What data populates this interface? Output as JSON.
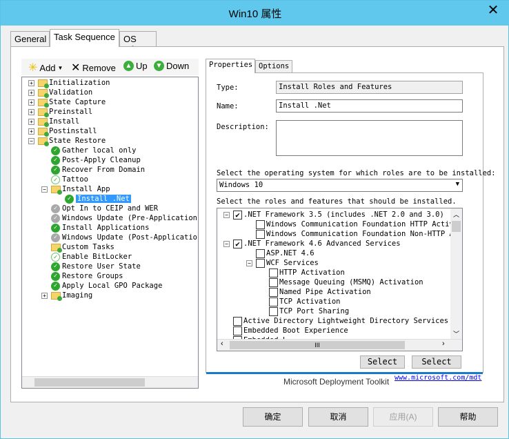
{
  "window": {
    "title": "Win10 属性",
    "close": "✕"
  },
  "tabs": [
    {
      "label": "General"
    },
    {
      "label": "Task Sequence",
      "active": true
    },
    {
      "label": "OS Info"
    }
  ],
  "toolbar": {
    "add": "Add",
    "remove": "Remove",
    "up": "Up",
    "down": "Down"
  },
  "tree": [
    {
      "label": "Initialization",
      "level": 0,
      "type": "folder",
      "expander": "+"
    },
    {
      "label": "Validation",
      "level": 0,
      "type": "folder",
      "expander": "+"
    },
    {
      "label": "State Capture",
      "level": 0,
      "type": "folder",
      "expander": "+"
    },
    {
      "label": "Preinstall",
      "level": 0,
      "type": "folder",
      "expander": "+"
    },
    {
      "label": "Install",
      "level": 0,
      "type": "folder",
      "expander": "+"
    },
    {
      "label": "Postinstall",
      "level": 0,
      "type": "folder",
      "expander": "+"
    },
    {
      "label": "State Restore",
      "level": 0,
      "type": "folder",
      "expander": "−"
    },
    {
      "label": "Gather local only",
      "level": 1,
      "type": "g"
    },
    {
      "label": "Post-Apply Cleanup",
      "level": 1,
      "type": "g"
    },
    {
      "label": "Recover From Domain",
      "level": 1,
      "type": "g"
    },
    {
      "label": "Tattoo",
      "level": 1,
      "type": "l"
    },
    {
      "label": "Install App",
      "level": 1,
      "type": "folder",
      "expander": "−"
    },
    {
      "label": "Install .Net",
      "level": 2,
      "type": "g",
      "selected": true
    },
    {
      "label": "Opt In to CEIP and WER",
      "level": 1,
      "type": "d"
    },
    {
      "label": "Windows Update (Pre-Application I",
      "level": 1,
      "type": "d"
    },
    {
      "label": "Install Applications",
      "level": 1,
      "type": "g"
    },
    {
      "label": "Windows Update (Post-Application",
      "level": 1,
      "type": "d"
    },
    {
      "label": "Custom Tasks",
      "level": 1,
      "type": "folder"
    },
    {
      "label": "Enable BitLocker",
      "level": 1,
      "type": "l"
    },
    {
      "label": "Restore User State",
      "level": 1,
      "type": "g"
    },
    {
      "label": "Restore Groups",
      "level": 1,
      "type": "g"
    },
    {
      "label": "Apply Local GPO Package",
      "level": 1,
      "type": "g"
    },
    {
      "label": "Imaging",
      "level": 1,
      "type": "folder",
      "expander": "+"
    }
  ],
  "right_tabs": [
    {
      "label": "Properties",
      "active": true
    },
    {
      "label": "Options"
    }
  ],
  "props": {
    "type_label": "Type:",
    "type_value": "Install Roles and Features",
    "name_label": "Name:",
    "name_value": "Install .Net",
    "desc_label": "Description:",
    "desc_value": "",
    "os_prompt": "Select the operating system for which roles are to be installed:",
    "os_value": "Windows 10",
    "roles_prompt": "Select the roles and features that should be installed.",
    "select_all": "Select",
    "select_none": "Select"
  },
  "roles": [
    {
      "label": ".NET Framework 3.5 (includes .NET 2.0 and 3.0)",
      "indent": 0,
      "checked": true,
      "expander": "−"
    },
    {
      "label": "Windows Communication Foundation HTTP Activatio",
      "indent": 1,
      "checked": false
    },
    {
      "label": "Windows Communication Foundation Non-HTTP Activ",
      "indent": 1,
      "checked": false
    },
    {
      "label": ".NET Framework 4.6 Advanced Services",
      "indent": 0,
      "checked": true,
      "expander": "−"
    },
    {
      "label": "ASP.NET 4.6",
      "indent": 1,
      "checked": false
    },
    {
      "label": "WCF Services",
      "indent": 1,
      "checked": false,
      "expander": "−"
    },
    {
      "label": "HTTP Activation",
      "indent": 2,
      "checked": false
    },
    {
      "label": "Message Queuing (MSMQ) Activation",
      "indent": 2,
      "checked": false
    },
    {
      "label": "Named Pipe Activation",
      "indent": 2,
      "checked": false
    },
    {
      "label": "TCP Activation",
      "indent": 2,
      "checked": false
    },
    {
      "label": "TCP Port Sharing",
      "indent": 2,
      "checked": false
    },
    {
      "label": "Active Directory Lightweight Directory Services",
      "indent": -1,
      "checked": false
    },
    {
      "label": "Embedded Boot Experience",
      "indent": -1,
      "checked": false
    },
    {
      "label": "Embedded L...",
      "indent": -1,
      "checked": false
    }
  ],
  "footer": {
    "brand": "Microsoft Deployment Toolkit",
    "link": "www.microsoft.com/mdt"
  },
  "buttons": {
    "ok": "确定",
    "cancel": "取消",
    "apply": "应用(A)",
    "help": "帮助"
  },
  "colors": {
    "titlebar": "#5fc8ec",
    "selection": "#3399ff",
    "accent_line": "#1979ca"
  }
}
